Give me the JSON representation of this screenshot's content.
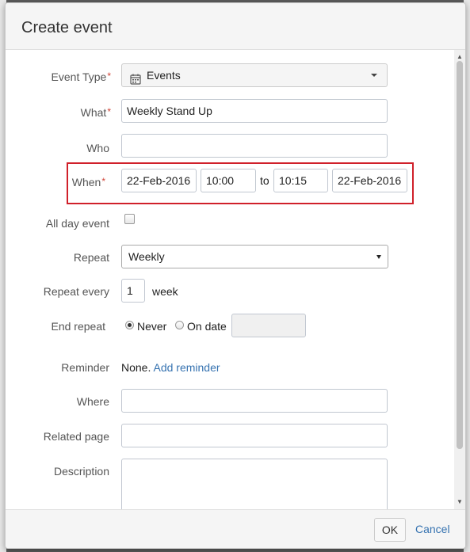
{
  "dialog": {
    "title": "Create event"
  },
  "form": {
    "event_type": {
      "label": "Event Type",
      "value": "Events"
    },
    "what": {
      "label": "What",
      "value": "Weekly Stand Up"
    },
    "who": {
      "label": "Who",
      "value": ""
    },
    "when": {
      "label": "When",
      "start_date": "22-Feb-2016",
      "start_time": "10:00",
      "separator": "to",
      "end_time": "10:15",
      "end_date": "22-Feb-2016"
    },
    "all_day": {
      "label": "All day event",
      "checked": false
    },
    "repeat": {
      "label": "Repeat",
      "value": "Weekly"
    },
    "repeat_every": {
      "label": "Repeat every",
      "value": "1",
      "unit": "week"
    },
    "end_repeat": {
      "label": "End repeat",
      "never_label": "Never",
      "on_date_label": "On date",
      "selected": "never",
      "date_value": ""
    },
    "reminder": {
      "label": "Reminder",
      "value": "None.",
      "link": "Add reminder"
    },
    "where": {
      "label": "Where",
      "value": ""
    },
    "related_page": {
      "label": "Related page",
      "value": ""
    },
    "description": {
      "label": "Description",
      "value": ""
    }
  },
  "footer": {
    "ok_label": "OK",
    "cancel_label": "Cancel"
  },
  "icons": {
    "calendar": "calendar-icon",
    "dropdown": "caret-down-icon",
    "scroll_up": "arrow-up-icon",
    "scroll_down": "arrow-down-icon"
  },
  "colors": {
    "required": "#d04437",
    "link": "#3572b0",
    "highlight_border": "#d0202a"
  }
}
